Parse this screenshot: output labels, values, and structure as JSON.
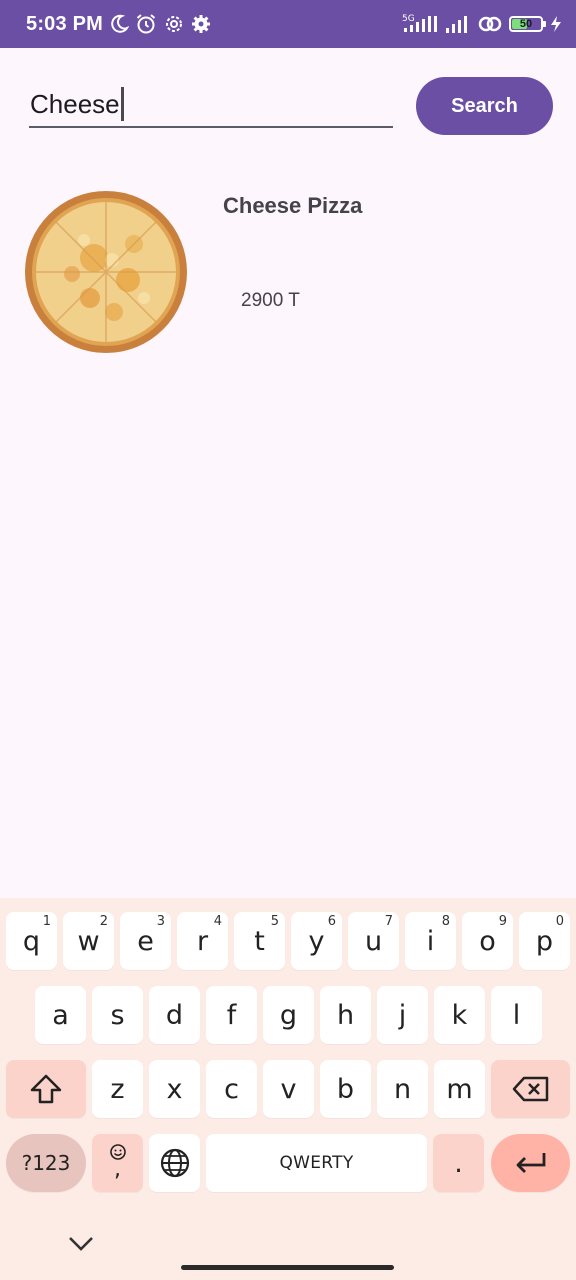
{
  "status_bar": {
    "time": "5:03 PM",
    "network": "5G",
    "battery": "50",
    "background": "#6B4FA5"
  },
  "search": {
    "value": "Cheese",
    "button_label": "Search"
  },
  "results": [
    {
      "name": "Cheese Pizza",
      "price": "2900 T",
      "image": "cheese-pizza"
    }
  ],
  "keyboard": {
    "row1": [
      {
        "key": "q",
        "hint": "1"
      },
      {
        "key": "w",
        "hint": "2"
      },
      {
        "key": "e",
        "hint": "3"
      },
      {
        "key": "r",
        "hint": "4"
      },
      {
        "key": "t",
        "hint": "5"
      },
      {
        "key": "y",
        "hint": "6"
      },
      {
        "key": "u",
        "hint": "7"
      },
      {
        "key": "i",
        "hint": "8"
      },
      {
        "key": "o",
        "hint": "9"
      },
      {
        "key": "p",
        "hint": "0"
      }
    ],
    "row2": [
      "a",
      "s",
      "d",
      "f",
      "g",
      "h",
      "j",
      "k",
      "l"
    ],
    "row3": [
      "z",
      "x",
      "c",
      "v",
      "b",
      "n",
      "m"
    ],
    "symbols_label": "?123",
    "emoji_comma": ",",
    "space_label": "QWERTY",
    "period": ".",
    "icons": [
      "shift-icon",
      "backspace-icon",
      "emoji-icon",
      "globe-icon",
      "enter-icon",
      "chevron-down-icon"
    ]
  },
  "colors": {
    "accent": "#6B4FA5",
    "background": "#FDF6FC",
    "keyboard_bg": "#FDECE6",
    "enter_key": "#FFB3A6"
  }
}
